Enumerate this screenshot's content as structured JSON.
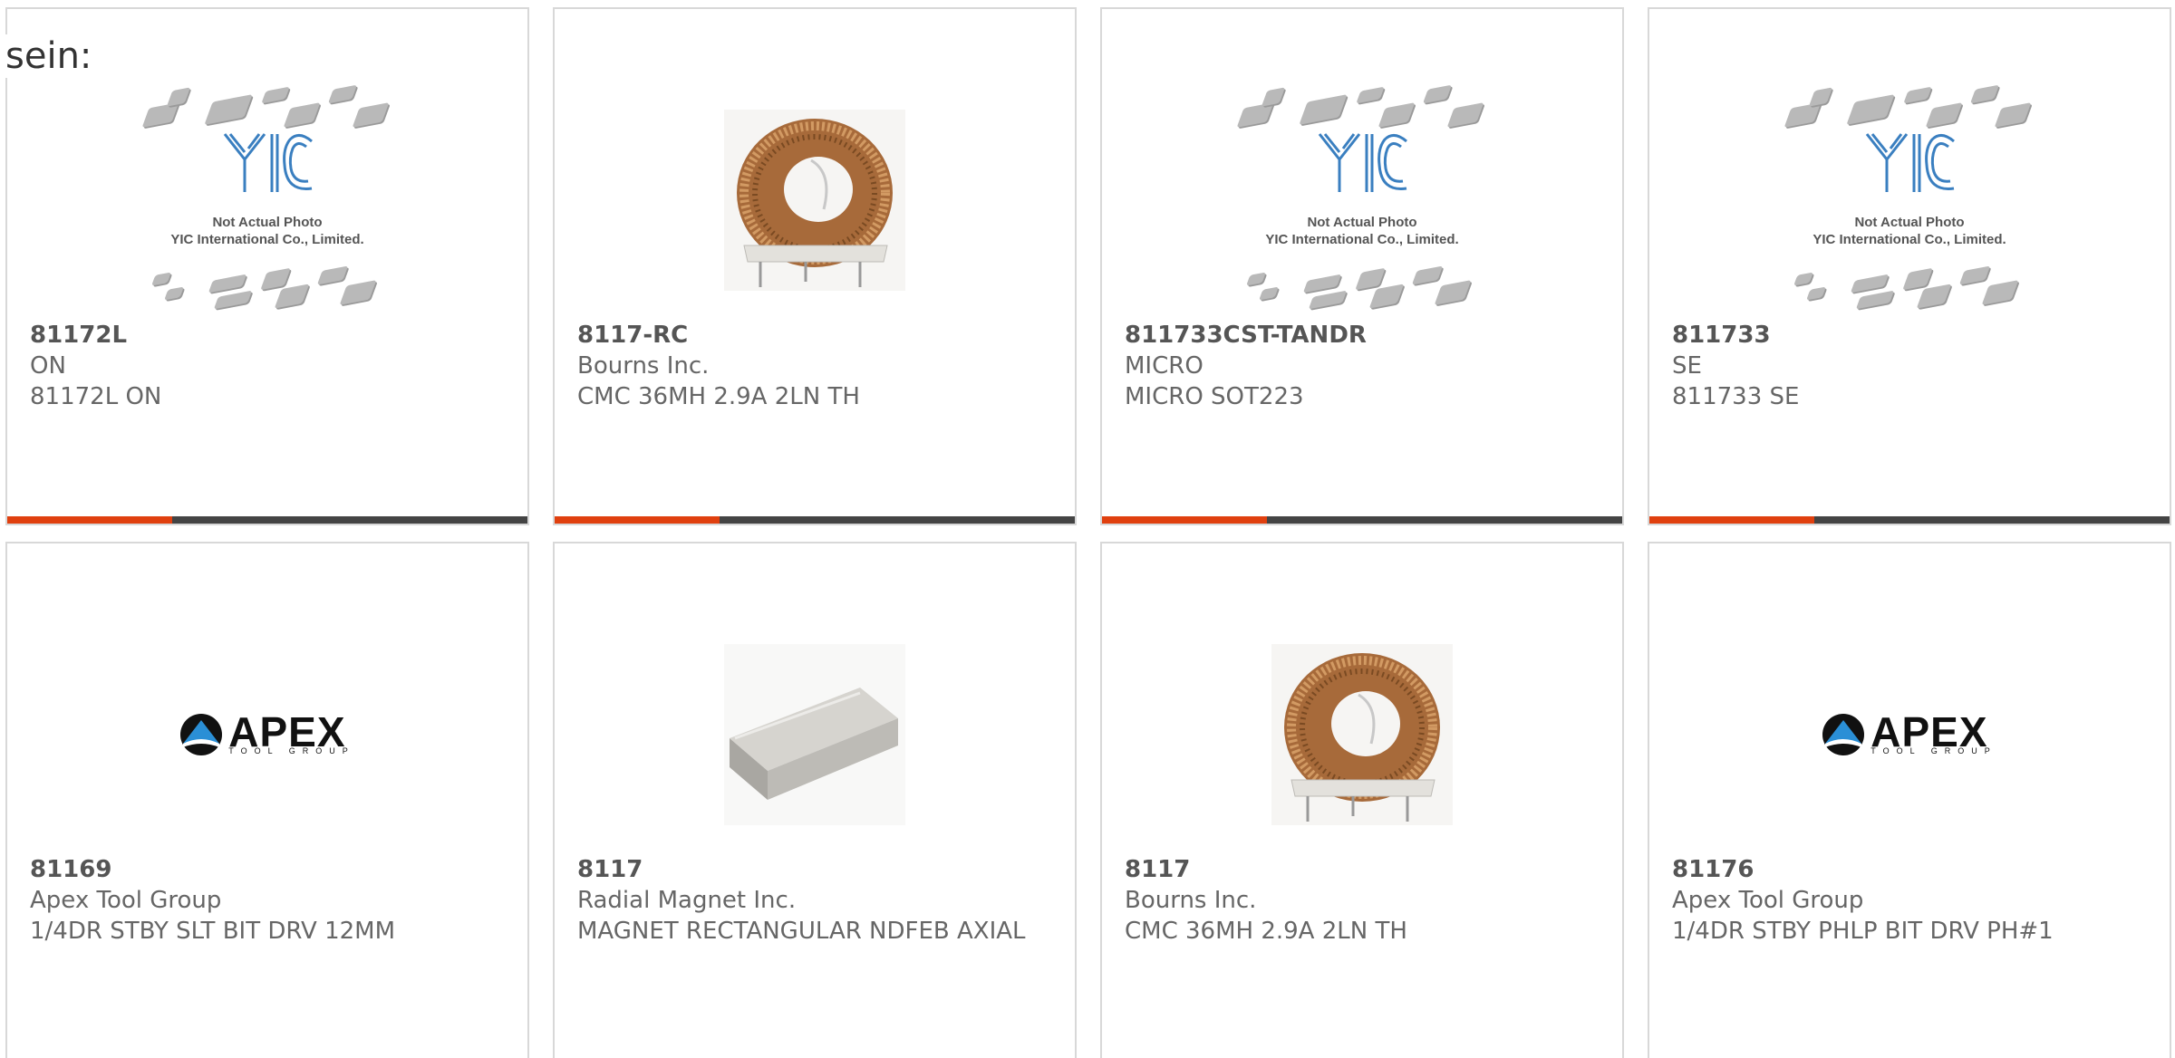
{
  "page": {
    "label": "sein:"
  },
  "products": [
    {
      "part_no": "81172L",
      "maker": "ON",
      "desc": "81172L ON",
      "image": "yic-placeholder"
    },
    {
      "part_no": "8117-RC",
      "maker": "Bourns Inc.",
      "desc": "CMC 36MH 2.9A 2LN TH",
      "image": "toroid-choke"
    },
    {
      "part_no": "811733CST-TANDR",
      "maker": "MICRO",
      "desc": "MICRO SOT223",
      "image": "yic-placeholder"
    },
    {
      "part_no": "811733",
      "maker": "SE",
      "desc": "811733 SE",
      "image": "yic-placeholder"
    },
    {
      "part_no": "81169",
      "maker": "Apex Tool Group",
      "desc": "1/4DR STBY SLT BIT DRV 12MM",
      "image": "apex-logo"
    },
    {
      "part_no": "8117",
      "maker": "Radial Magnet Inc.",
      "desc": "MAGNET RECTANGULAR NDFEB AXIAL",
      "image": "rect-magnet"
    },
    {
      "part_no": "8117",
      "maker": "Bourns Inc.",
      "desc": "CMC 36MH 2.9A 2LN TH",
      "image": "toroid-choke"
    },
    {
      "part_no": "81176",
      "maker": "Apex Tool Group",
      "desc": "1/4DR STBY PHLP BIT DRV PH#1",
      "image": "apex-logo"
    }
  ],
  "placeholder": {
    "logo_text": "YIC",
    "caption_line1": "Not Actual Photo",
    "caption_line2": "YIC International Co., Limited."
  },
  "apex": {
    "word": "APEX",
    "sub": "TOOL GROUP"
  },
  "colors": {
    "accent": "#e0400f",
    "bar": "#444444",
    "border": "#d8d8d8",
    "text": "#666666"
  }
}
